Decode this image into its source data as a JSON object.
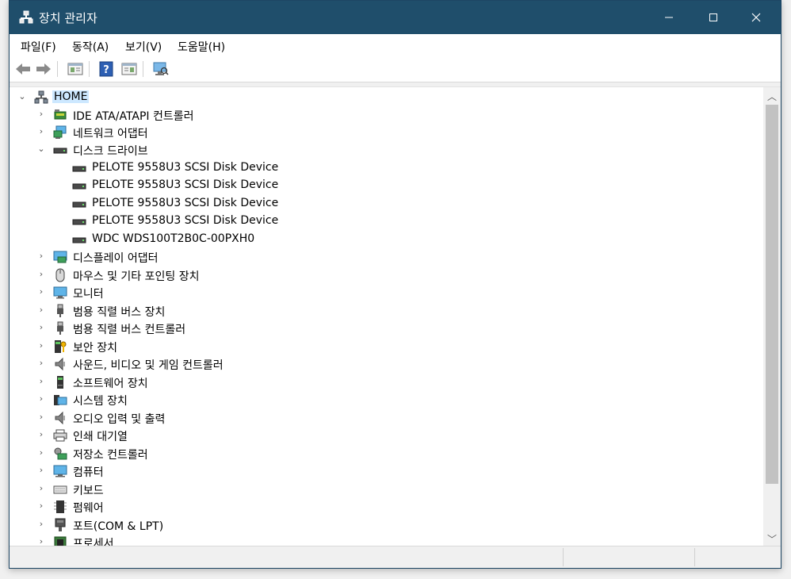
{
  "window": {
    "title": "장치 관리자",
    "titlebar_color": "#1f4e6b",
    "controls": [
      "minimize-icon",
      "maximize-icon",
      "close-icon"
    ]
  },
  "menu": {
    "items": [
      "파일(F)",
      "동작(A)",
      "보기(V)",
      "도움말(H)"
    ]
  },
  "toolbar": {
    "buttons": [
      "back-arrow-icon",
      "forward-arrow-icon",
      "properties-icon",
      "help-icon",
      "toggle-pane-icon",
      "scan-hardware-icon"
    ]
  },
  "tree": {
    "root": "HOME",
    "items": [
      {
        "label": "IDE ATA/ATAPI 컨트롤러",
        "icon": "ide-controller-icon",
        "expanded": false
      },
      {
        "label": "네트워크 어댑터",
        "icon": "network-adapter-icon",
        "expanded": false
      },
      {
        "label": "디스크 드라이브",
        "icon": "disk-drive-icon",
        "expanded": true,
        "children": [
          "PELOTE 9558U3 SCSI Disk Device",
          "PELOTE 9558U3 SCSI Disk Device",
          "PELOTE 9558U3 SCSI Disk Device",
          "PELOTE 9558U3 SCSI Disk Device",
          "WDC WDS100T2B0C-00PXH0"
        ]
      },
      {
        "label": "디스플레이 어댑터",
        "icon": "display-adapter-icon",
        "expanded": false
      },
      {
        "label": "마우스 및 기타 포인팅 장치",
        "icon": "mouse-icon",
        "expanded": false
      },
      {
        "label": "모니터",
        "icon": "monitor-icon",
        "expanded": false
      },
      {
        "label": "범용 직렬 버스 장치",
        "icon": "usb-icon",
        "expanded": false
      },
      {
        "label": "범용 직렬 버스 컨트롤러",
        "icon": "usb-icon",
        "expanded": false
      },
      {
        "label": "보안 장치",
        "icon": "security-device-icon",
        "expanded": false
      },
      {
        "label": "사운드, 비디오 및 게임 컨트롤러",
        "icon": "speaker-icon",
        "expanded": false
      },
      {
        "label": "소프트웨어 장치",
        "icon": "software-device-icon",
        "expanded": false
      },
      {
        "label": "시스템 장치",
        "icon": "system-device-icon",
        "expanded": false
      },
      {
        "label": "오디오 입력 및 출력",
        "icon": "speaker-icon",
        "expanded": false
      },
      {
        "label": "인쇄 대기열",
        "icon": "printer-icon",
        "expanded": false
      },
      {
        "label": "저장소 컨트롤러",
        "icon": "storage-controller-icon",
        "expanded": false
      },
      {
        "label": "컴퓨터",
        "icon": "computer-icon",
        "expanded": false
      },
      {
        "label": "키보드",
        "icon": "keyboard-icon",
        "expanded": false
      },
      {
        "label": "펌웨어",
        "icon": "firmware-icon",
        "expanded": false
      },
      {
        "label": "포트(COM & LPT)",
        "icon": "port-icon",
        "expanded": false
      },
      {
        "label": "프로세서",
        "icon": "processor-icon",
        "expanded": false
      }
    ]
  }
}
